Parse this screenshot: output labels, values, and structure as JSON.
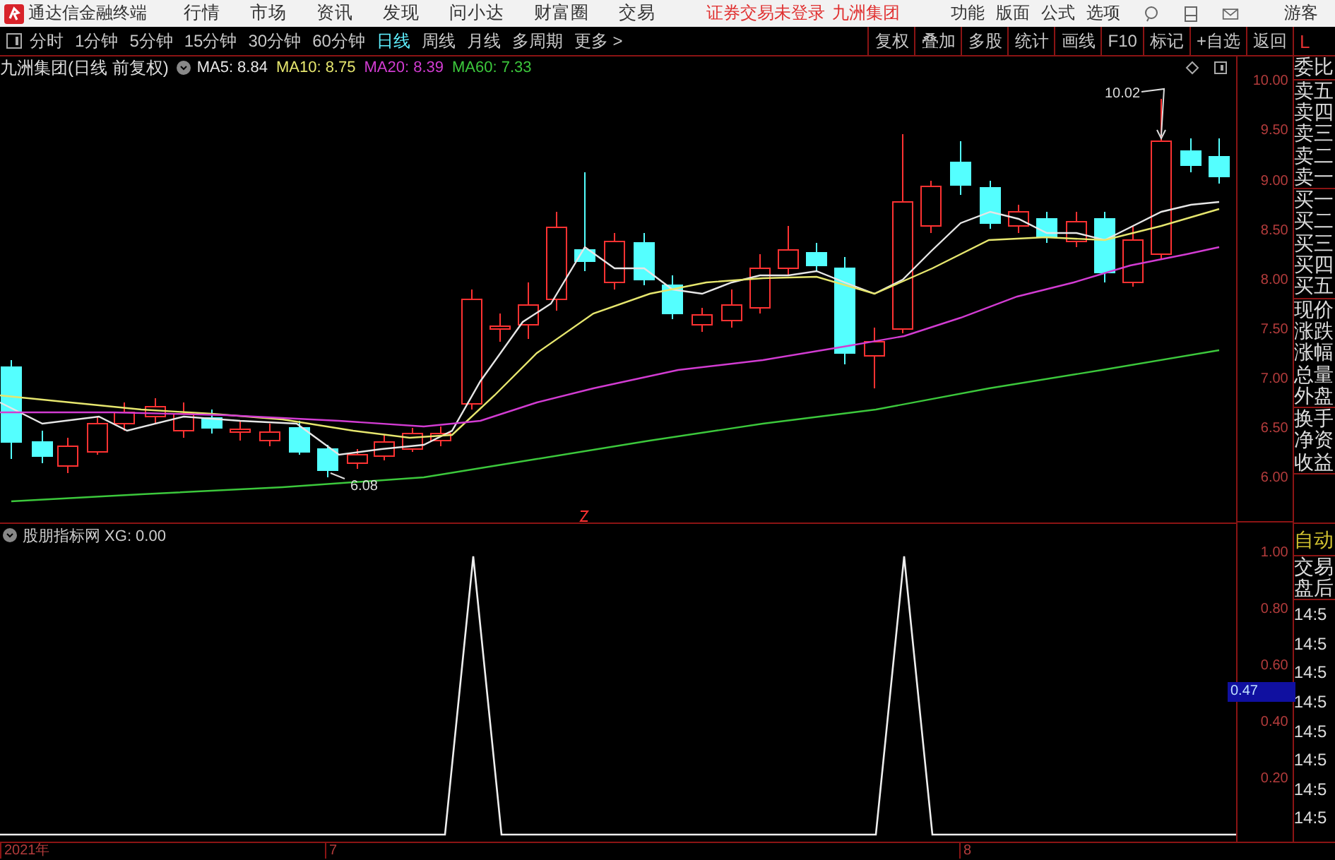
{
  "app": {
    "title": "通达信金融终端",
    "menu": [
      "行情",
      "市场",
      "资讯",
      "发现",
      "问小达",
      "财富圈",
      "交易"
    ],
    "login_notice": "证券交易未登录",
    "stock_name": "九洲集团",
    "right_menu": [
      "功能",
      "版面",
      "公式",
      "选项"
    ],
    "user": "游客"
  },
  "toolbar": {
    "periods": [
      {
        "label": "分时",
        "selected": false
      },
      {
        "label": "1分钟",
        "selected": false
      },
      {
        "label": "5分钟",
        "selected": false
      },
      {
        "label": "15分钟",
        "selected": false
      },
      {
        "label": "30分钟",
        "selected": false
      },
      {
        "label": "60分钟",
        "selected": false
      },
      {
        "label": "日线",
        "selected": true
      },
      {
        "label": "周线",
        "selected": false
      },
      {
        "label": "月线",
        "selected": false
      },
      {
        "label": "多周期",
        "selected": false
      },
      {
        "label": "更多 >",
        "selected": false
      }
    ],
    "buttons": [
      "复权",
      "叠加",
      "多股",
      "统计",
      "画线",
      "F10",
      "标记",
      "+自选",
      "返回"
    ],
    "panel_toggle": "L"
  },
  "chart": {
    "title": "九洲集团(日线 前复权)",
    "ma": [
      {
        "label": "MA5: 8.84",
        "color": "#e6e6e6"
      },
      {
        "label": "MA10: 8.75",
        "color": "#e6e66e"
      },
      {
        "label": "MA20: 8.39",
        "color": "#d23cd2"
      },
      {
        "label": "MA60: 7.33",
        "color": "#3cc83c"
      }
    ],
    "high_label": "10.02",
    "low_label": "6.08",
    "yticks": [
      "10.00",
      "9.50",
      "9.00",
      "8.50",
      "8.00",
      "7.50",
      "7.00",
      "6.50",
      "6.00"
    ]
  },
  "indicator": {
    "title": "股朋指标网 XG: 0.00",
    "yticks": [
      "1.00",
      "0.80",
      "0.60",
      "0.40",
      "0.20"
    ],
    "current": "0.47"
  },
  "xaxis": [
    "2021年",
    "7",
    "8"
  ],
  "side_panel": {
    "groups": [
      [
        "委比"
      ],
      [
        "卖五",
        "卖四",
        "卖三",
        "卖二",
        "卖一"
      ],
      [
        "买一",
        "买二",
        "买三",
        "买四",
        "买五"
      ],
      [
        "现价",
        "涨跌",
        "涨幅",
        "总量",
        "外盘"
      ],
      [
        "换手",
        "净资",
        "收益"
      ]
    ],
    "mode": "自动",
    "lower": [
      "交易",
      "盘后"
    ],
    "times": [
      "14:5",
      "14:5",
      "14:5",
      "14:5",
      "14:5",
      "14:5",
      "14:5",
      "14:5"
    ]
  }
}
